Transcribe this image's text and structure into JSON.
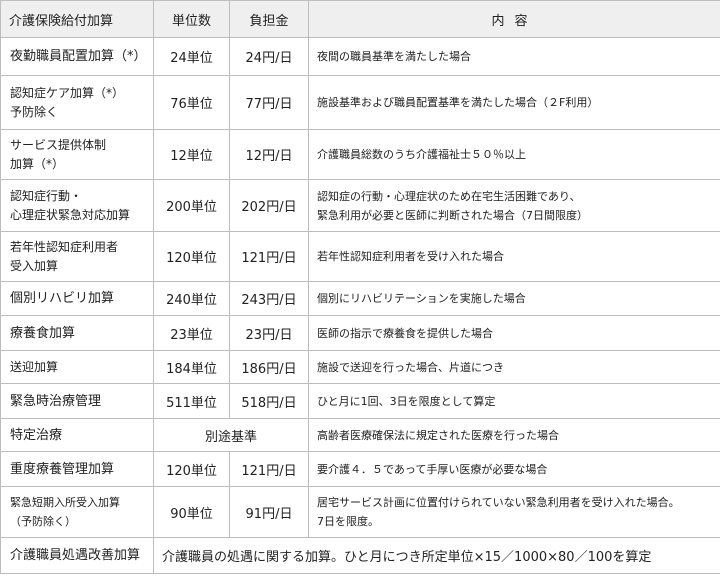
{
  "headers": {
    "item": "介護保険給付加算",
    "units": "単位数",
    "cost": "負担金",
    "content": "内容"
  },
  "rows": [
    {
      "name": [
        "夜勤職員配置加算（*）"
      ],
      "units": "24単位",
      "cost": "24円/日",
      "content": [
        "夜間の職員基準を満たした場合"
      ]
    },
    {
      "name": [
        "認知症ケア加算（*）",
        "予防除く"
      ],
      "units": "76単位",
      "cost": "77円/日",
      "content": [
        "施設基準および職員配置基準を満たした場合（２F利用）"
      ]
    },
    {
      "name": [
        "サービス提供体制",
        "加算（*）"
      ],
      "units": "12単位",
      "cost": "12円/日",
      "content": [
        "介護職員総数のうち介護福祉士５０％以上"
      ]
    },
    {
      "name": [
        "認知症行動・",
        "心理症状緊急対応加算"
      ],
      "units": "200単位",
      "cost": "202円/日",
      "content": [
        "認知症の行動・心理症状のため在宅生活困難であり、",
        "緊急利用が必要と医師に判断された場合（7日間限度）"
      ]
    },
    {
      "name": [
        "若年性認知症利用者",
        "受入加算"
      ],
      "units": "120単位",
      "cost": "121円/日",
      "content": [
        "若年性認知症利用者を受け入れた場合"
      ]
    },
    {
      "name": [
        "個別リハビリ加算"
      ],
      "units": "240単位",
      "cost": "243円/日",
      "content": [
        "個別にリハビリテーションを実施した場合"
      ]
    },
    {
      "name": [
        "療養食加算"
      ],
      "units": "23単位",
      "cost": "23円/日",
      "content": [
        "医師の指示で療養食を提供した場合"
      ]
    },
    {
      "name": [
        "送迎加算"
      ],
      "units": "184単位",
      "cost": "186円/日",
      "content": [
        "施設で送迎を行った場合、片道につき"
      ]
    },
    {
      "name": [
        "緊急時治療管理"
      ],
      "units": "511単位",
      "cost": "518円/日",
      "content": [
        "ひと月に1回、3日を限度として算定"
      ]
    },
    {
      "name": [
        "特定治療"
      ],
      "merged": "別途基準",
      "content": [
        "高齢者医療確保法に規定された医療を行った場合"
      ]
    },
    {
      "name": [
        "重度療養管理加算"
      ],
      "units": "120単位",
      "cost": "121円/日",
      "content": [
        "要介護４．５であって手厚い医療が必要な場合"
      ]
    },
    {
      "name": [
        "緊急短期入所受入加算",
        "（予防除く）"
      ],
      "units": "90単位",
      "cost": "91円/日",
      "content": [
        "居宅サービス計画に位置付けられていない緊急利用者を受け入れた場合。",
        "7日を限度。"
      ]
    }
  ],
  "footer": {
    "name": "介護職員処遇改善加算",
    "content": "介護職員の処遇に関する加算。ひと月につき所定単位×15／1000×80／100を算定"
  }
}
